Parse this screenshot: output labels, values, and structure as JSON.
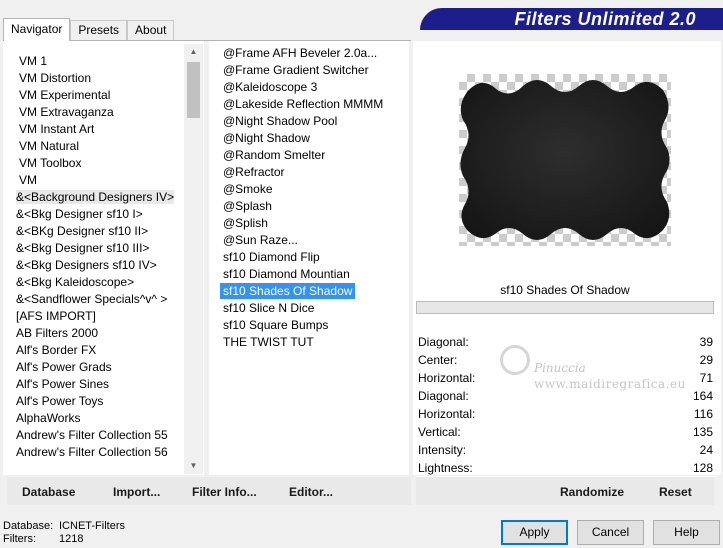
{
  "tabs": [
    "Navigator",
    "Presets",
    "About"
  ],
  "banner": {
    "title": "Filters Unlimited 2.0"
  },
  "categories": [
    "VM 1",
    "VM Distortion",
    "VM Experimental",
    "VM Extravaganza",
    "VM Instant Art",
    "VM Natural",
    "VM Toolbox",
    "VM",
    "&<Background Designers IV>",
    "&<Bkg Designer sf10 I>",
    "&<BKg Designer sf10 II>",
    "&<Bkg Designer sf10 III>",
    "&<Bkg Designers sf10 IV>",
    "&<Bkg Kaleidoscope>",
    "&<Sandflower Specials^v^ >",
    "[AFS IMPORT]",
    "AB Filters 2000",
    "Alf's Border FX",
    "Alf's Power Grads",
    "Alf's Power Sines",
    "Alf's Power Toys",
    "AlphaWorks",
    "Andrew's Filter Collection 55",
    "Andrew's Filter Collection 56"
  ],
  "filters": [
    "@Frame AFH Beveler 2.0a...",
    "@Frame Gradient Switcher",
    "@Kaleidoscope 3",
    "@Lakeside Reflection MMMM",
    "@Night Shadow Pool",
    "@Night Shadow",
    "@Random Smelter",
    "@Refractor",
    "@Smoke",
    "@Splash",
    "@Splish",
    "@Sun Raze...",
    "sf10 Diamond Flip",
    "sf10 Diamond Mountian",
    "sf10 Shades Of Shadow",
    "sf10 Slice N Dice",
    "sf10 Square Bumps",
    "THE TWIST TUT"
  ],
  "selected_filter": "sf10 Shades Of Shadow",
  "params": [
    {
      "label": "Diagonal:",
      "value": "39"
    },
    {
      "label": "Center:",
      "value": "29"
    },
    {
      "label": "Horizontal:",
      "value": "71"
    },
    {
      "label": "Diagonal:",
      "value": "164"
    },
    {
      "label": "Horizontal:",
      "value": "116"
    },
    {
      "label": "Vertical:",
      "value": "135"
    },
    {
      "label": "Intensity:",
      "value": "24"
    },
    {
      "label": "Lightness:",
      "value": "128"
    }
  ],
  "left_buttons": {
    "database": "Database",
    "import": "Import...",
    "filter_info": "Filter Info...",
    "editor": "Editor..."
  },
  "right_buttons": {
    "randomize": "Randomize",
    "reset": "Reset"
  },
  "status": {
    "database_label": "Database:",
    "database_value": "ICNET-Filters",
    "filters_label": "Filters:",
    "filters_value": "1218"
  },
  "dialog": {
    "apply": "Apply",
    "cancel": "Cancel",
    "help": "Help"
  },
  "watermark": {
    "line1": "Pinuccia",
    "line2": "www.maidiregrafica.eu"
  },
  "colors": {
    "banner": "#1c1e8c",
    "selection": "#3392f2",
    "default_button_border": "#0078d7"
  }
}
